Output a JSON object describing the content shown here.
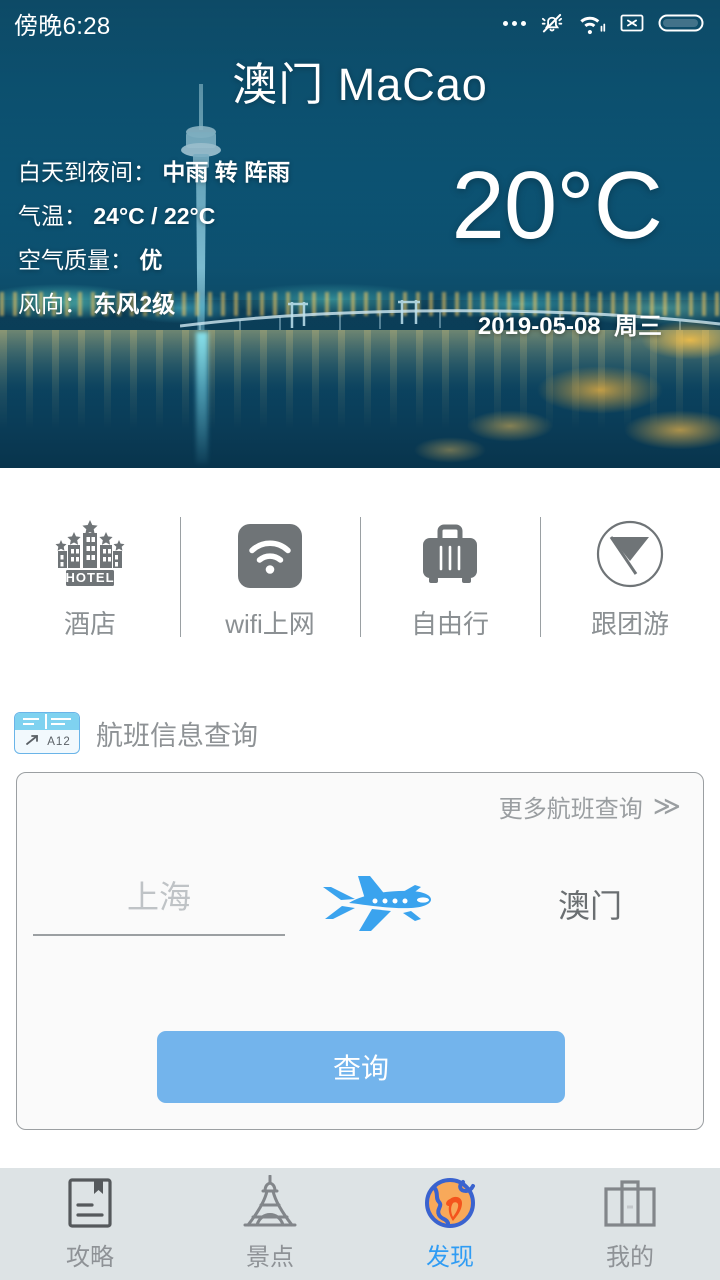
{
  "status_bar": {
    "clock": "傍晚6:28",
    "icons": [
      "more-dots",
      "bell-muted-icon",
      "wifi-icon",
      "no-sim-icon",
      "battery-icon"
    ]
  },
  "hero": {
    "city_title": "澳门  MaCao",
    "weather": {
      "condition_label": "白天到夜间：",
      "condition_value": "中雨 转 阵雨",
      "temp_label": "气温：",
      "temp_value": "24°C / 22°C",
      "air_label": "空气质量：",
      "air_value": "优",
      "wind_label": "风向：",
      "wind_value": "东风2级"
    },
    "current_temp": "20°C",
    "date": "2019-05-08",
    "weekday": "周三"
  },
  "quick_actions": [
    {
      "label": "酒店",
      "icon": "hotel-icon"
    },
    {
      "label": "wifi上网",
      "icon": "wifi-square-icon"
    },
    {
      "label": "自由行",
      "icon": "suitcase-icon"
    },
    {
      "label": "跟团游",
      "icon": "group-tour-icon"
    }
  ],
  "flight": {
    "section_title": "航班信息查询",
    "badge_icon": "departure-board-icon",
    "badge_text": "A12",
    "more_label": "更多航班查询",
    "more_chevron": "≫",
    "from_placeholder": "上海",
    "from_value": "",
    "plane_icon": "airplane-icon",
    "to_value": "澳门",
    "query_label": "查询"
  },
  "tabbar": {
    "active_index": 2,
    "items": [
      {
        "label": "攻略",
        "icon": "guide-book-icon"
      },
      {
        "label": "景点",
        "icon": "eiffel-tower-icon"
      },
      {
        "label": "发现",
        "icon": "globe-icon"
      },
      {
        "label": "我的",
        "icon": "briefcase-icon"
      }
    ]
  },
  "colors": {
    "accent_blue": "#2f9cf4",
    "button_blue": "#73b4ec",
    "plane_blue": "#3aa3ee",
    "muted_gray": "#8e9296",
    "tabbar_bg": "#dde3e5",
    "globe_ring": "#3a63cf",
    "globe_land": "#f8a95a",
    "globe_accent": "#f4541d"
  }
}
